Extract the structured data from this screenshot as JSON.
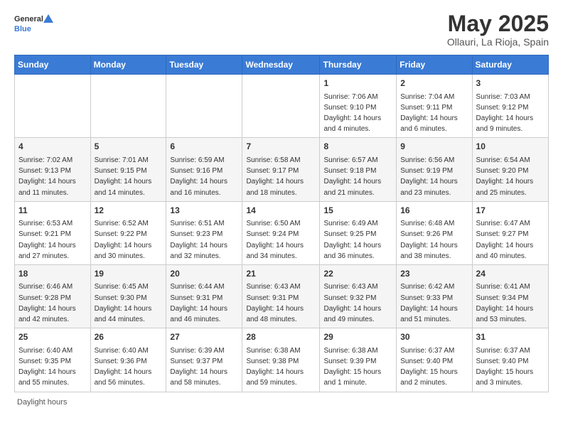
{
  "header": {
    "logo_general": "General",
    "logo_blue": "Blue",
    "month_title": "May 2025",
    "location": "Ollauri, La Rioja, Spain"
  },
  "days_of_week": [
    "Sunday",
    "Monday",
    "Tuesday",
    "Wednesday",
    "Thursday",
    "Friday",
    "Saturday"
  ],
  "weeks": [
    [
      {
        "day": "",
        "sunrise": "",
        "sunset": "",
        "daylight": ""
      },
      {
        "day": "",
        "sunrise": "",
        "sunset": "",
        "daylight": ""
      },
      {
        "day": "",
        "sunrise": "",
        "sunset": "",
        "daylight": ""
      },
      {
        "day": "",
        "sunrise": "",
        "sunset": "",
        "daylight": ""
      },
      {
        "day": "1",
        "sunrise": "Sunrise: 7:06 AM",
        "sunset": "Sunset: 9:10 PM",
        "daylight": "Daylight: 14 hours and 4 minutes."
      },
      {
        "day": "2",
        "sunrise": "Sunrise: 7:04 AM",
        "sunset": "Sunset: 9:11 PM",
        "daylight": "Daylight: 14 hours and 6 minutes."
      },
      {
        "day": "3",
        "sunrise": "Sunrise: 7:03 AM",
        "sunset": "Sunset: 9:12 PM",
        "daylight": "Daylight: 14 hours and 9 minutes."
      }
    ],
    [
      {
        "day": "4",
        "sunrise": "Sunrise: 7:02 AM",
        "sunset": "Sunset: 9:13 PM",
        "daylight": "Daylight: 14 hours and 11 minutes."
      },
      {
        "day": "5",
        "sunrise": "Sunrise: 7:01 AM",
        "sunset": "Sunset: 9:15 PM",
        "daylight": "Daylight: 14 hours and 14 minutes."
      },
      {
        "day": "6",
        "sunrise": "Sunrise: 6:59 AM",
        "sunset": "Sunset: 9:16 PM",
        "daylight": "Daylight: 14 hours and 16 minutes."
      },
      {
        "day": "7",
        "sunrise": "Sunrise: 6:58 AM",
        "sunset": "Sunset: 9:17 PM",
        "daylight": "Daylight: 14 hours and 18 minutes."
      },
      {
        "day": "8",
        "sunrise": "Sunrise: 6:57 AM",
        "sunset": "Sunset: 9:18 PM",
        "daylight": "Daylight: 14 hours and 21 minutes."
      },
      {
        "day": "9",
        "sunrise": "Sunrise: 6:56 AM",
        "sunset": "Sunset: 9:19 PM",
        "daylight": "Daylight: 14 hours and 23 minutes."
      },
      {
        "day": "10",
        "sunrise": "Sunrise: 6:54 AM",
        "sunset": "Sunset: 9:20 PM",
        "daylight": "Daylight: 14 hours and 25 minutes."
      }
    ],
    [
      {
        "day": "11",
        "sunrise": "Sunrise: 6:53 AM",
        "sunset": "Sunset: 9:21 PM",
        "daylight": "Daylight: 14 hours and 27 minutes."
      },
      {
        "day": "12",
        "sunrise": "Sunrise: 6:52 AM",
        "sunset": "Sunset: 9:22 PM",
        "daylight": "Daylight: 14 hours and 30 minutes."
      },
      {
        "day": "13",
        "sunrise": "Sunrise: 6:51 AM",
        "sunset": "Sunset: 9:23 PM",
        "daylight": "Daylight: 14 hours and 32 minutes."
      },
      {
        "day": "14",
        "sunrise": "Sunrise: 6:50 AM",
        "sunset": "Sunset: 9:24 PM",
        "daylight": "Daylight: 14 hours and 34 minutes."
      },
      {
        "day": "15",
        "sunrise": "Sunrise: 6:49 AM",
        "sunset": "Sunset: 9:25 PM",
        "daylight": "Daylight: 14 hours and 36 minutes."
      },
      {
        "day": "16",
        "sunrise": "Sunrise: 6:48 AM",
        "sunset": "Sunset: 9:26 PM",
        "daylight": "Daylight: 14 hours and 38 minutes."
      },
      {
        "day": "17",
        "sunrise": "Sunrise: 6:47 AM",
        "sunset": "Sunset: 9:27 PM",
        "daylight": "Daylight: 14 hours and 40 minutes."
      }
    ],
    [
      {
        "day": "18",
        "sunrise": "Sunrise: 6:46 AM",
        "sunset": "Sunset: 9:28 PM",
        "daylight": "Daylight: 14 hours and 42 minutes."
      },
      {
        "day": "19",
        "sunrise": "Sunrise: 6:45 AM",
        "sunset": "Sunset: 9:30 PM",
        "daylight": "Daylight: 14 hours and 44 minutes."
      },
      {
        "day": "20",
        "sunrise": "Sunrise: 6:44 AM",
        "sunset": "Sunset: 9:31 PM",
        "daylight": "Daylight: 14 hours and 46 minutes."
      },
      {
        "day": "21",
        "sunrise": "Sunrise: 6:43 AM",
        "sunset": "Sunset: 9:31 PM",
        "daylight": "Daylight: 14 hours and 48 minutes."
      },
      {
        "day": "22",
        "sunrise": "Sunrise: 6:43 AM",
        "sunset": "Sunset: 9:32 PM",
        "daylight": "Daylight: 14 hours and 49 minutes."
      },
      {
        "day": "23",
        "sunrise": "Sunrise: 6:42 AM",
        "sunset": "Sunset: 9:33 PM",
        "daylight": "Daylight: 14 hours and 51 minutes."
      },
      {
        "day": "24",
        "sunrise": "Sunrise: 6:41 AM",
        "sunset": "Sunset: 9:34 PM",
        "daylight": "Daylight: 14 hours and 53 minutes."
      }
    ],
    [
      {
        "day": "25",
        "sunrise": "Sunrise: 6:40 AM",
        "sunset": "Sunset: 9:35 PM",
        "daylight": "Daylight: 14 hours and 55 minutes."
      },
      {
        "day": "26",
        "sunrise": "Sunrise: 6:40 AM",
        "sunset": "Sunset: 9:36 PM",
        "daylight": "Daylight: 14 hours and 56 minutes."
      },
      {
        "day": "27",
        "sunrise": "Sunrise: 6:39 AM",
        "sunset": "Sunset: 9:37 PM",
        "daylight": "Daylight: 14 hours and 58 minutes."
      },
      {
        "day": "28",
        "sunrise": "Sunrise: 6:38 AM",
        "sunset": "Sunset: 9:38 PM",
        "daylight": "Daylight: 14 hours and 59 minutes."
      },
      {
        "day": "29",
        "sunrise": "Sunrise: 6:38 AM",
        "sunset": "Sunset: 9:39 PM",
        "daylight": "Daylight: 15 hours and 1 minute."
      },
      {
        "day": "30",
        "sunrise": "Sunrise: 6:37 AM",
        "sunset": "Sunset: 9:40 PM",
        "daylight": "Daylight: 15 hours and 2 minutes."
      },
      {
        "day": "31",
        "sunrise": "Sunrise: 6:37 AM",
        "sunset": "Sunset: 9:40 PM",
        "daylight": "Daylight: 15 hours and 3 minutes."
      }
    ]
  ],
  "footer": {
    "daylight_label": "Daylight hours"
  }
}
